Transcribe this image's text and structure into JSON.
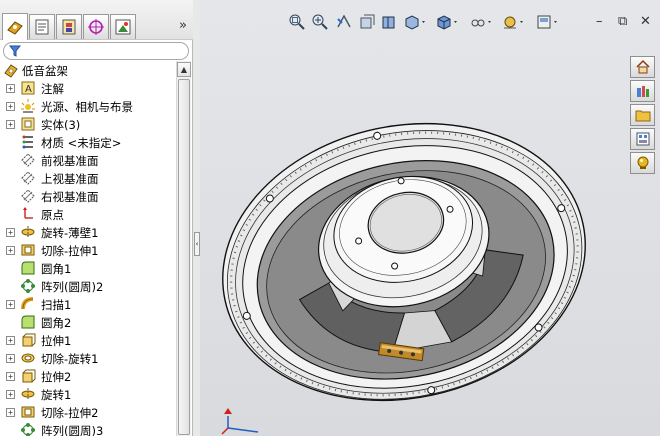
{
  "panel": {
    "tabs": [
      "feature-manager-icon",
      "property-manager-icon",
      "configuration-manager-icon",
      "dimxpert-icon",
      "display-manager-icon"
    ],
    "expand_more": "»",
    "filter_icon": "filter-icon"
  },
  "tree": {
    "root": {
      "label": "低音盆架",
      "icon": "part-icon"
    },
    "items": [
      {
        "label": "注解",
        "icon": "annotation-icon",
        "expandable": true
      },
      {
        "label": "光源、相机与布景",
        "icon": "lights-icon",
        "expandable": true
      },
      {
        "label": "实体(3)",
        "icon": "solid-bodies-icon",
        "expandable": true
      },
      {
        "label": "材质 <未指定>",
        "icon": "material-icon",
        "expandable": false
      },
      {
        "label": "前视基准面",
        "icon": "plane-icon",
        "expandable": false
      },
      {
        "label": "上视基准面",
        "icon": "plane-icon",
        "expandable": false
      },
      {
        "label": "右视基准面",
        "icon": "plane-icon",
        "expandable": false
      },
      {
        "label": "原点",
        "icon": "origin-icon",
        "expandable": false
      },
      {
        "label": "旋转-薄壁1",
        "icon": "revolve-icon",
        "expandable": true
      },
      {
        "label": "切除-拉伸1",
        "icon": "cut-extrude-icon",
        "expandable": true
      },
      {
        "label": "圆角1",
        "icon": "fillet-icon",
        "expandable": false
      },
      {
        "label": "阵列(圆周)2",
        "icon": "circular-pattern-icon",
        "expandable": false
      },
      {
        "label": "扫描1",
        "icon": "sweep-icon",
        "expandable": true
      },
      {
        "label": "圆角2",
        "icon": "fillet-icon",
        "expandable": false
      },
      {
        "label": "拉伸1",
        "icon": "extrude-icon",
        "expandable": true
      },
      {
        "label": "切除-旋转1",
        "icon": "cut-revolve-icon",
        "expandable": true
      },
      {
        "label": "拉伸2",
        "icon": "extrude-icon",
        "expandable": true
      },
      {
        "label": "旋转1",
        "icon": "revolve-icon",
        "expandable": true
      },
      {
        "label": "切除-拉伸2",
        "icon": "cut-extrude-icon",
        "expandable": true
      },
      {
        "label": "阵列(圆周)3",
        "icon": "circular-pattern-icon",
        "expandable": false
      }
    ]
  },
  "view_toolbar": [
    "zoom-to-fit-icon",
    "zoom-to-area-icon",
    "previous-view-icon",
    "section-view-icon",
    "view-orientation-icon",
    "display-style-icon",
    "hide-show-items-icon",
    "edit-appearance-icon",
    "apply-scene-icon",
    "view-settings-icon"
  ],
  "window_controls": {
    "minimize": "–",
    "restore": "⧉",
    "close": "✕"
  },
  "task_pane": [
    "home-icon",
    "design-library-icon",
    "file-explorer-icon",
    "view-palette-icon",
    "appearances-icon"
  ],
  "colors": {
    "viewport_bg": "#dcdee2",
    "model_face": "#ececec",
    "model_edge": "#1a1a1a",
    "model_dark": "#6e6e6e",
    "selection_blue": "#1f5fbf"
  }
}
